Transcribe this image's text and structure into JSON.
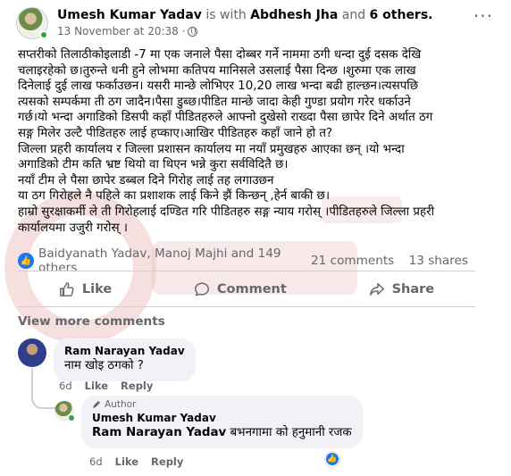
{
  "post": {
    "author": "Umesh Kumar Yadav",
    "with_text": "is with",
    "tagged": "Abdhesh Jha",
    "and_text": "and",
    "others": "6 others.",
    "time": "13 November at 20:38 ·",
    "body": [
      "सप्तरीको तिलाठीकोइलाडी -7 मा एक जनाले पैसा दोब्बर गर्ने नाममा ठगी धन्दा दुई दसक देखि",
      "चलाइरहेको छ।तुरुन्ते धनी हुने लोभमा कतिपय मानिसले उसलाई पैसा दिन्छ ।शुरुमा एक लाख",
      "दिनेलाई दुई लाख फर्काउछन। यसरी मान्छे लोभिएर 10,20 लाख  भन्दा बढी हाल्छन।त्यसपछि",
      "त्यसको सम्पर्कमा ती ठग जादैन।पैसा डुब्छ।पीडित मान्छे जादा केही गुण्डा प्रयोग गरेर धर्काउने",
      "गर्छ।यो भन्दा अगाडिको डिसपी कहाँ पीडितहरुले आफ्नो दुखेसो राख्दा पैसा छापेर दिने अर्थात ठग",
      "सङ्ग मिलेर उल्टै  पीडितहरु लाई हप्काए।आखिर पीडितहरु कहाँ जाने हो त?",
      "जिल्ला प्रहरी कार्यालय र जिल्ला प्रशासन कार्यालय मा  नयाँ प्रमुखहरु आएका छन् ।यो भन्दा",
      "अगाडिको टीम कति भ्रष्ट थियो वा थिएन भन्ने कुरा सर्वविदितै छ।",
      "नयाँ टीम ले पैसा छापेर डब्बल दिने गिरोह लाई तह लगाउछन",
      "या ठग गिरोहले नै पहिले का प्रशाशक लाई किने झैं किन्छन् ,हेर्न बाकी छ।",
      "हाम्रो सुरक्षाकर्मी ले ती गिरोहलाई दण्डित गरि पीडितहरु सङ्ग न्याय गरोस् ।पीडितहरुले जिल्ला प्रहरी",
      "कार्यालयमा उजुरी गरोस् ।"
    ]
  },
  "reactions": {
    "names": "Baidyanath Yadav, Manoj Majhi and 149 others",
    "comments": "21 comments",
    "shares": "13 shares"
  },
  "actions": {
    "like": "Like",
    "comment": "Comment",
    "share": "Share"
  },
  "view_more": "View more comments",
  "comments": [
    {
      "name": "Ram Narayan Yadav",
      "text": "नाम खोइ ठगको ?",
      "time": "6d",
      "like": "Like",
      "reply": "Reply"
    }
  ],
  "reply": {
    "author_badge": "Author",
    "name": "Umesh Kumar Yadav",
    "tag": "Ram Narayan Yadav",
    "text": " बभनगामा को हनुमानी रजक",
    "time": "6d",
    "like": "Like",
    "reply": "Reply"
  },
  "colors": {
    "facebook_blue": "#1877f2",
    "secondary_text": "#65676b",
    "bubble_bg": "#f0f2f5",
    "online_green": "#31a24c"
  }
}
